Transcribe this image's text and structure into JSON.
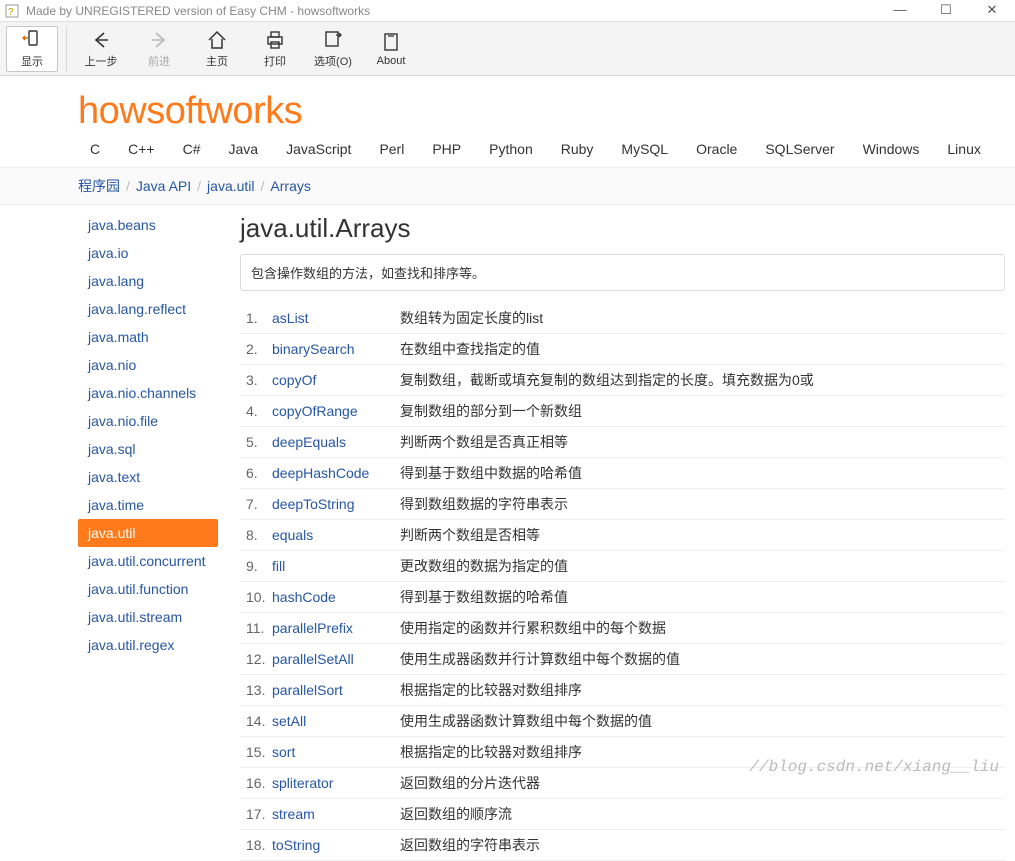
{
  "window": {
    "title": "Made by UNREGISTERED version of Easy CHM - howsoftworks"
  },
  "toolbar": [
    {
      "key": "show",
      "label": "显示",
      "disabled": false,
      "selected": true,
      "icon": "phone-arrow"
    },
    {
      "key": "back",
      "label": "上一步",
      "disabled": false,
      "selected": false,
      "icon": "arrow-left"
    },
    {
      "key": "fwd",
      "label": "前进",
      "disabled": true,
      "selected": false,
      "icon": "arrow-right"
    },
    {
      "key": "home",
      "label": "主页",
      "disabled": false,
      "selected": false,
      "icon": "home"
    },
    {
      "key": "print",
      "label": "打印",
      "disabled": false,
      "selected": false,
      "icon": "printer"
    },
    {
      "key": "opts",
      "label": "选项(O)",
      "disabled": false,
      "selected": false,
      "icon": "options"
    },
    {
      "key": "about",
      "label": "About",
      "disabled": false,
      "selected": false,
      "icon": "about"
    }
  ],
  "logo": "howsoftworks",
  "topnav": [
    "C",
    "C++",
    "C#",
    "Java",
    "JavaScript",
    "Perl",
    "PHP",
    "Python",
    "Ruby",
    "MySQL",
    "Oracle",
    "SQLServer",
    "Windows",
    "Linux"
  ],
  "breadcrumb": [
    "程序园",
    "Java API",
    "java.util",
    "Arrays"
  ],
  "sidebar": [
    {
      "label": "java.beans",
      "active": false
    },
    {
      "label": "java.io",
      "active": false
    },
    {
      "label": "java.lang",
      "active": false
    },
    {
      "label": "java.lang.reflect",
      "active": false
    },
    {
      "label": "java.math",
      "active": false
    },
    {
      "label": "java.nio",
      "active": false
    },
    {
      "label": "java.nio.channels",
      "active": false
    },
    {
      "label": "java.nio.file",
      "active": false
    },
    {
      "label": "java.sql",
      "active": false
    },
    {
      "label": "java.text",
      "active": false
    },
    {
      "label": "java.time",
      "active": false
    },
    {
      "label": "java.util",
      "active": true
    },
    {
      "label": "java.util.concurrent",
      "active": false
    },
    {
      "label": "java.util.function",
      "active": false
    },
    {
      "label": "java.util.stream",
      "active": false
    },
    {
      "label": "java.util.regex",
      "active": false
    }
  ],
  "page": {
    "title": "java.util.Arrays",
    "desc": "包含操作数组的方法，如查找和排序等。",
    "methods": [
      {
        "n": "1.",
        "name": "asList",
        "desc": "数组转为固定长度的list"
      },
      {
        "n": "2.",
        "name": "binarySearch",
        "desc": "在数组中查找指定的值"
      },
      {
        "n": "3.",
        "name": "copyOf",
        "desc": "复制数组，截断或填充复制的数组达到指定的长度。填充数据为0或"
      },
      {
        "n": "4.",
        "name": "copyOfRange",
        "desc": "复制数组的部分到一个新数组"
      },
      {
        "n": "5.",
        "name": "deepEquals",
        "desc": "判断两个数组是否真正相等"
      },
      {
        "n": "6.",
        "name": "deepHashCode",
        "desc": "得到基于数组中数据的哈希值"
      },
      {
        "n": "7.",
        "name": "deepToString",
        "desc": "得到数组数据的字符串表示"
      },
      {
        "n": "8.",
        "name": "equals",
        "desc": "判断两个数组是否相等"
      },
      {
        "n": "9.",
        "name": "fill",
        "desc": "更改数组的数据为指定的值"
      },
      {
        "n": "10.",
        "name": "hashCode",
        "desc": "得到基于数组数据的哈希值"
      },
      {
        "n": "11.",
        "name": "parallelPrefix",
        "desc": "使用指定的函数并行累积数组中的每个数据"
      },
      {
        "n": "12.",
        "name": "parallelSetAll",
        "desc": "使用生成器函数并行计算数组中每个数据的值"
      },
      {
        "n": "13.",
        "name": "parallelSort",
        "desc": "根据指定的比较器对数组排序"
      },
      {
        "n": "14.",
        "name": "setAll",
        "desc": "使用生成器函数计算数组中每个数据的值"
      },
      {
        "n": "15.",
        "name": "sort",
        "desc": "根据指定的比较器对数组排序"
      },
      {
        "n": "16.",
        "name": "spliterator",
        "desc": "返回数组的分片迭代器"
      },
      {
        "n": "17.",
        "name": "stream",
        "desc": "返回数组的顺序流"
      },
      {
        "n": "18.",
        "name": "toString",
        "desc": "返回数组的字符串表示"
      }
    ]
  },
  "watermark": "//blog.csdn.net/xiang__liu"
}
